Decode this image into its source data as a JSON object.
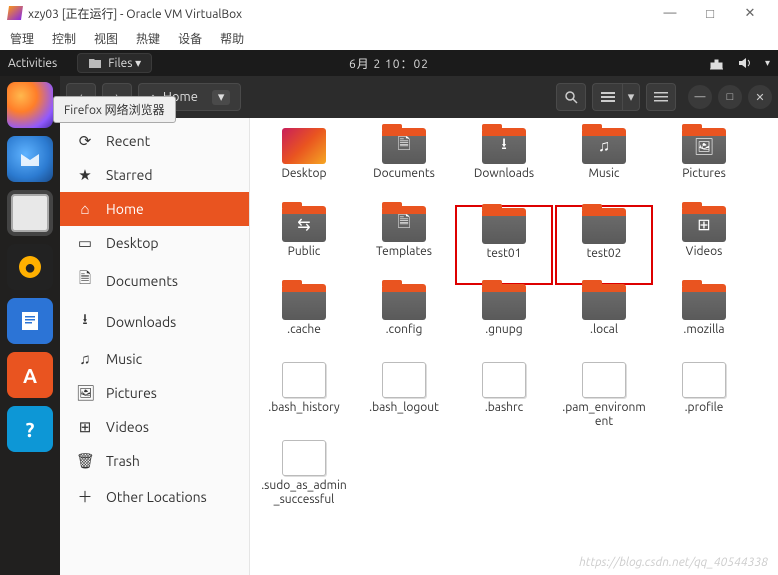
{
  "virtualbox": {
    "title": "xzy03 [正在运行] - Oracle VM VirtualBox",
    "menu": [
      "管理",
      "控制",
      "视图",
      "热键",
      "设备",
      "帮助"
    ],
    "window_buttons": {
      "min": "—",
      "max": "□",
      "close": "✕"
    }
  },
  "topbar": {
    "activities": "Activities",
    "files_label": "Files ▾",
    "clock": "6月 2  10：02"
  },
  "tooltip": "Firefox 网络浏览器",
  "header": {
    "back": "‹",
    "fwd": "›",
    "home_icon": "⌂",
    "path": "Home",
    "path_caret": "▾",
    "search": "Q",
    "min": "—",
    "max": "□",
    "close": "✕"
  },
  "sidebar": {
    "items": [
      {
        "icon": "⟳",
        "label": "Recent"
      },
      {
        "icon": "★",
        "label": "Starred"
      },
      {
        "icon": "⌂",
        "label": "Home"
      },
      {
        "icon": "▭",
        "label": "Desktop"
      },
      {
        "icon": "🗎",
        "label": "Documents"
      },
      {
        "icon": "⭳",
        "label": "Downloads"
      },
      {
        "icon": "♫",
        "label": "Music"
      },
      {
        "icon": "🖼",
        "label": "Pictures"
      },
      {
        "icon": "⊞",
        "label": "Videos"
      },
      {
        "icon": "🗑",
        "label": "Trash"
      },
      {
        "icon": "＋",
        "label": "Other Locations"
      }
    ],
    "active_index": 2
  },
  "grid": {
    "items": [
      {
        "type": "accent",
        "icon": "",
        "label": "Desktop"
      },
      {
        "type": "folder",
        "icon": "🗎",
        "label": "Documents"
      },
      {
        "type": "folder",
        "icon": "⭳",
        "label": "Downloads"
      },
      {
        "type": "folder",
        "icon": "♫",
        "label": "Music"
      },
      {
        "type": "folder",
        "icon": "🖼",
        "label": "Pictures"
      },
      {
        "type": "folder",
        "icon": "⇆",
        "label": "Public"
      },
      {
        "type": "folder",
        "icon": "🗎",
        "label": "Templates"
      },
      {
        "type": "folder",
        "icon": "",
        "label": "test01",
        "highlight": true
      },
      {
        "type": "folder",
        "icon": "",
        "label": "test02",
        "highlight": true
      },
      {
        "type": "folder",
        "icon": "⊞",
        "label": "Videos"
      },
      {
        "type": "folder",
        "icon": "",
        "label": ".cache"
      },
      {
        "type": "folder",
        "icon": "",
        "label": ".config"
      },
      {
        "type": "folder",
        "icon": "",
        "label": ".gnupg"
      },
      {
        "type": "folder",
        "icon": "",
        "label": ".local"
      },
      {
        "type": "folder",
        "icon": "",
        "label": ".mozilla"
      },
      {
        "type": "file",
        "icon": "",
        "label": ".bash_history"
      },
      {
        "type": "file",
        "icon": "",
        "label": ".bash_logout"
      },
      {
        "type": "file",
        "icon": "",
        "label": ".bashrc"
      },
      {
        "type": "file",
        "icon": "",
        "label": ".pam_environment"
      },
      {
        "type": "file",
        "icon": "",
        "label": ".profile"
      },
      {
        "type": "file",
        "icon": "",
        "label": ".sudo_as_admin_successful"
      }
    ]
  },
  "watermark": "https://blog.csdn.net/qq_40544338"
}
